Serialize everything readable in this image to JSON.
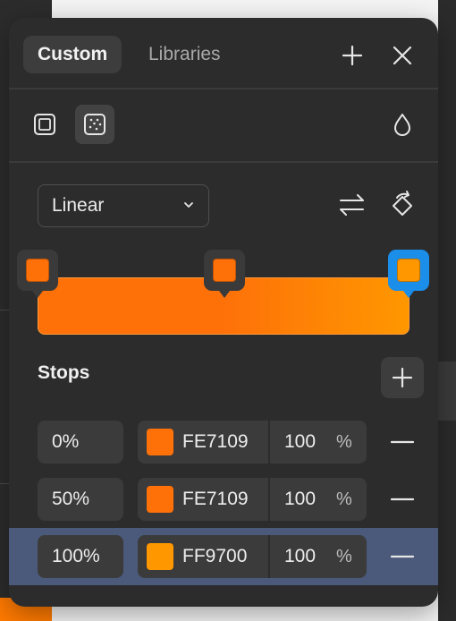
{
  "tabs": [
    {
      "label": "Custom",
      "active": true
    },
    {
      "label": "Libraries",
      "active": false
    }
  ],
  "icons": {
    "add": "plus-icon",
    "close": "close-icon",
    "solid_fill": "solid-fill-icon",
    "image_fill": "image-fill-icon",
    "opacity": "drop-icon",
    "swap": "swap-arrows-icon",
    "rotate": "rotate-icon",
    "chevron": "chevron-down-icon",
    "remove": "minus-icon"
  },
  "gradient": {
    "type_label": "Linear",
    "handles": [
      {
        "position": 0,
        "color": "#FE7109",
        "active": false
      },
      {
        "position": 50,
        "color": "#FE7109",
        "active": false
      },
      {
        "position": 100,
        "color": "#FF9700",
        "active": true
      }
    ]
  },
  "stops": {
    "title": "Stops",
    "rows": [
      {
        "position": "0%",
        "hex": "FE7109",
        "color": "#FE7109",
        "opacity": "100",
        "unit": "%",
        "selected": false
      },
      {
        "position": "50%",
        "hex": "FE7109",
        "color": "#FE7109",
        "opacity": "100",
        "unit": "%",
        "selected": false
      },
      {
        "position": "100%",
        "hex": "FF9700",
        "color": "#FF9700",
        "opacity": "100",
        "unit": "%",
        "selected": true
      }
    ]
  },
  "colors": {
    "accent": "#1B8EEA",
    "selected_row": "#4B5A7A",
    "panel": "#2C2C2C"
  }
}
